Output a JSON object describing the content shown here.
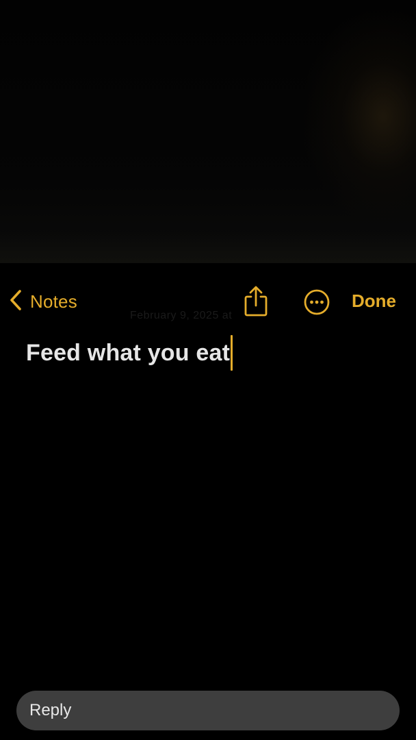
{
  "nav": {
    "back_label": "Notes",
    "done_label": "Done",
    "accent_color": "#e5ad2b",
    "back_icon": "chevron-left-icon",
    "share_icon": "share-icon",
    "more_icon": "ellipsis-circle-icon"
  },
  "note": {
    "ghost_date": "February 9, 2025 at",
    "text": "Feed what you eat"
  },
  "reply": {
    "placeholder": "Reply"
  }
}
